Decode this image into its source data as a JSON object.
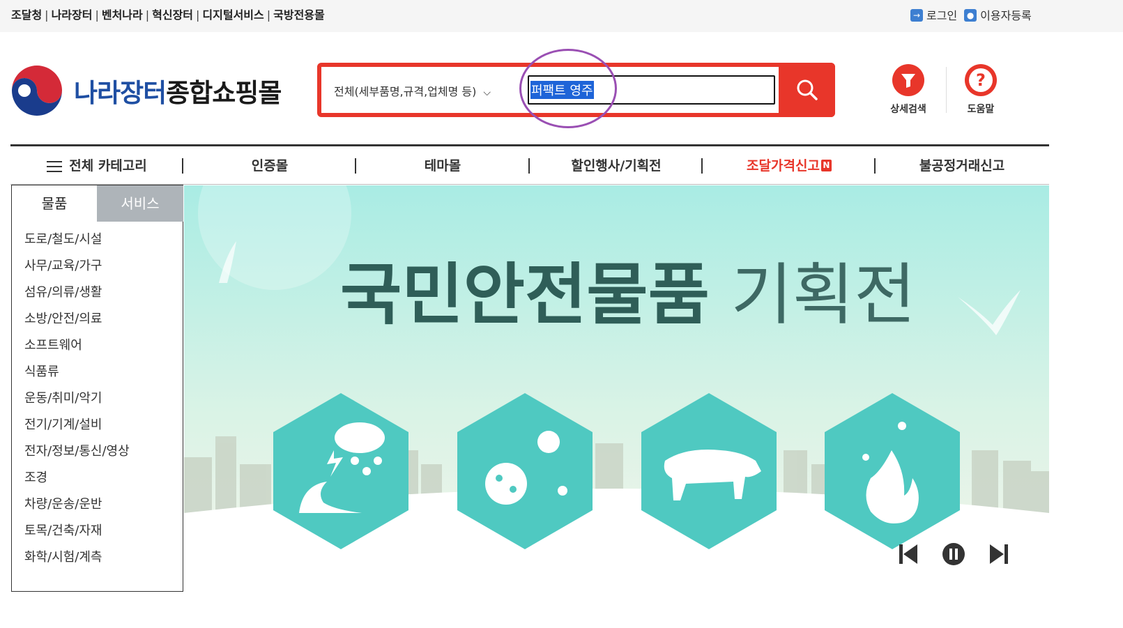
{
  "top_links": [
    "조달청",
    "나라장터",
    "벤처나라",
    "혁신장터",
    "디지털서비스",
    "국방전용몰"
  ],
  "top_right": {
    "login": "로그인",
    "register": "이용자등록"
  },
  "logo": {
    "part1": "나라장터",
    "part2": "종합쇼핑몰"
  },
  "search": {
    "scope": "전체(세부품명,규격,업체명 등)",
    "query": "퍼팩트 영주"
  },
  "header_icons": [
    {
      "name": "filter-icon",
      "label": "상세검색"
    },
    {
      "name": "help-icon",
      "label": "도움말",
      "glyph": "?"
    }
  ],
  "nav": [
    {
      "label": "전체 카테고리"
    },
    {
      "label": "인증몰"
    },
    {
      "label": "테마몰"
    },
    {
      "label": "할인행사/기획전"
    },
    {
      "label": "조달가격신고",
      "badge": "N"
    },
    {
      "label": "불공정거래신고"
    }
  ],
  "side_tabs": {
    "active": "물품",
    "inactive": "서비스"
  },
  "categories": [
    "도로/철도/시설",
    "사무/교육/가구",
    "섬유/의류/생활",
    "소방/안전/의료",
    "소프트웨어",
    "식품류",
    "운동/취미/악기",
    "전기/기계/설비",
    "전자/정보/통신/영상",
    "조경",
    "차량/운송/운반",
    "토목/건축/자재",
    "화학/시험/계측"
  ],
  "banner": {
    "title_bold": "국민안전물품",
    "title_light": " 기획전"
  },
  "colors": {
    "accent": "#e8362a",
    "banner_teal": "#4fc9c1",
    "logo_blue": "#1f4fa3",
    "selection": "#1e64d8"
  }
}
